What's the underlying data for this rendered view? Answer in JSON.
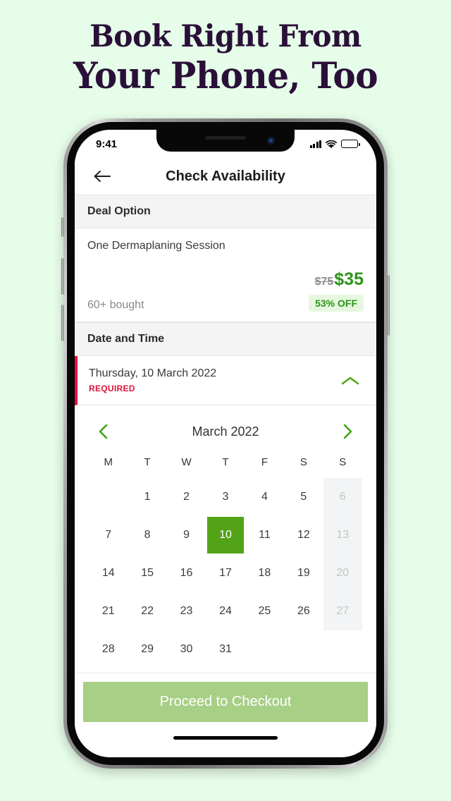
{
  "headline": {
    "line1": "Book Right From",
    "line2": "Your Phone, Too"
  },
  "status_bar": {
    "time": "9:41",
    "signal_icon": "cellular-signal-icon",
    "wifi_icon": "wifi-icon",
    "battery_icon": "battery-full-icon"
  },
  "nav": {
    "back_icon": "arrow-left-icon",
    "title": "Check Availability"
  },
  "deal_section": {
    "header": "Deal Option",
    "option_title": "One Dermaplaning Session",
    "bought": "60+ bought",
    "price_original": "$75",
    "price_current": "$35",
    "discount_badge": "53% OFF"
  },
  "datetime_section": {
    "header": "Date and Time",
    "selected_label": "Thursday, 10 March 2022",
    "required_label": "REQUIRED",
    "collapse_icon": "chevron-up-icon"
  },
  "calendar": {
    "prev_icon": "chevron-left-icon",
    "next_icon": "chevron-right-icon",
    "month_label": "March 2022",
    "weekdays": [
      "M",
      "T",
      "W",
      "T",
      "F",
      "S",
      "S"
    ],
    "selected_day": 10,
    "disabled_days": [
      6,
      13,
      20,
      27
    ],
    "leading_blanks": 1,
    "weeks": [
      [
        "",
        "1",
        "2",
        "3",
        "4",
        "5",
        "6"
      ],
      [
        "7",
        "8",
        "9",
        "10",
        "11",
        "12",
        "13"
      ],
      [
        "14",
        "15",
        "16",
        "17",
        "18",
        "19",
        "20"
      ],
      [
        "21",
        "22",
        "23",
        "24",
        "25",
        "26",
        "27"
      ],
      [
        "28",
        "29",
        "30",
        "31",
        "",
        "",
        ""
      ]
    ]
  },
  "cta": {
    "label": "Proceed to Checkout"
  },
  "colors": {
    "page_background": "#e6fde9",
    "headline": "#2a1038",
    "accent_green": "#53a318",
    "price_green": "#2b9416",
    "badge_background": "#e6f7e0",
    "required_red": "#e0123c",
    "cta_background": "#a7cf85",
    "section_header_background": "#f4f4f4"
  }
}
